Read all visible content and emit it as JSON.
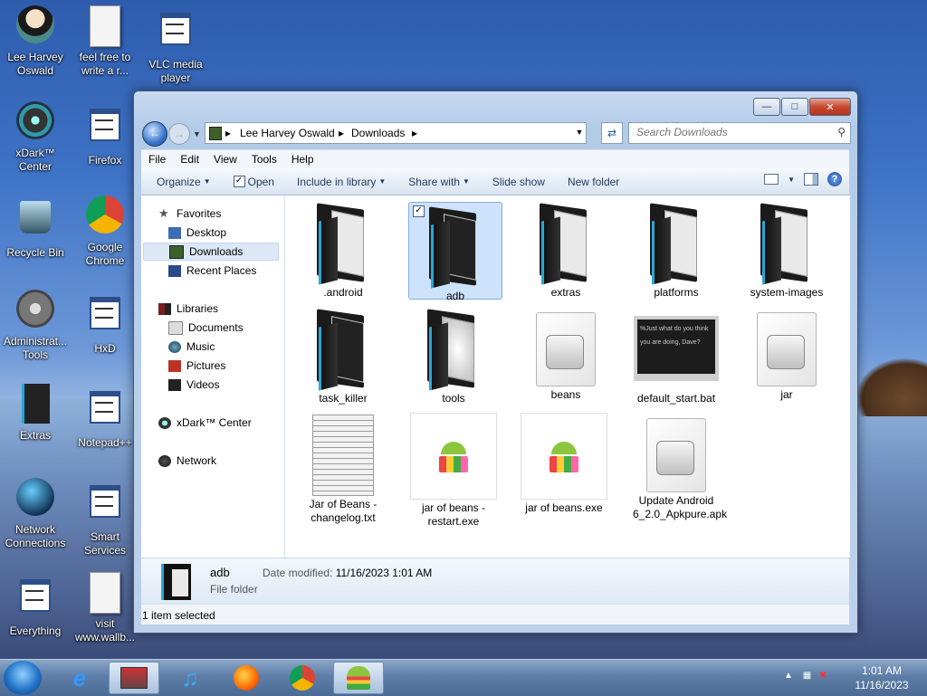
{
  "desktop": {
    "icons": [
      {
        "label": "Lee Harvey Oswald"
      },
      {
        "label": "feel free to write a r..."
      },
      {
        "label": "VLC media player"
      },
      {
        "label": "xDark™ Center"
      },
      {
        "label": "Firefox"
      },
      {
        "label": "Recycle Bin"
      },
      {
        "label": "Google Chrome"
      },
      {
        "label": "Administrat... Tools"
      },
      {
        "label": "HxD"
      },
      {
        "label": "Extras"
      },
      {
        "label": "Notepad++"
      },
      {
        "label": "Network Connections"
      },
      {
        "label": "Smart Services"
      },
      {
        "label": "Everything"
      },
      {
        "label": "visit www.wallb..."
      }
    ]
  },
  "window": {
    "address": {
      "crumbs": [
        "Lee Harvey Oswald",
        "Downloads"
      ]
    },
    "search": {
      "placeholder": "Search Downloads"
    },
    "menu": [
      "File",
      "Edit",
      "View",
      "Tools",
      "Help"
    ],
    "commands": {
      "organize": "Organize",
      "open": "Open",
      "include": "Include in library",
      "share": "Share with",
      "slideshow": "Slide show",
      "newfolder": "New folder"
    },
    "nav": {
      "favorites": "Favorites",
      "desktop": "Desktop",
      "downloads": "Downloads",
      "recent": "Recent Places",
      "libraries": "Libraries",
      "documents": "Documents",
      "music": "Music",
      "pictures": "Pictures",
      "videos": "Videos",
      "xdark": "xDark™ Center",
      "network": "Network"
    },
    "files": [
      {
        "name": ".android"
      },
      {
        "name": "adb"
      },
      {
        "name": "extras"
      },
      {
        "name": "platforms"
      },
      {
        "name": "system-images"
      },
      {
        "name": "task_killer"
      },
      {
        "name": "tools"
      },
      {
        "name": "beans"
      },
      {
        "name": "default_start.bat"
      },
      {
        "name": "jar"
      },
      {
        "name": "Jar of Beans - changelog.txt"
      },
      {
        "name": "jar of beans - restart.exe"
      },
      {
        "name": "jar of beans.exe"
      },
      {
        "name": "Update Android 6_2.0_Apkpure.apk"
      }
    ],
    "details": {
      "name": "adb",
      "modified_label": "Date modified:",
      "modified": "11/16/2023 1:01 AM",
      "type": "File folder"
    },
    "status": "1 item selected",
    "bat_preview": "%Just what do you think you are doing, Dave?"
  },
  "taskbar": {
    "time": "1:01 AM",
    "date": "11/16/2023"
  }
}
